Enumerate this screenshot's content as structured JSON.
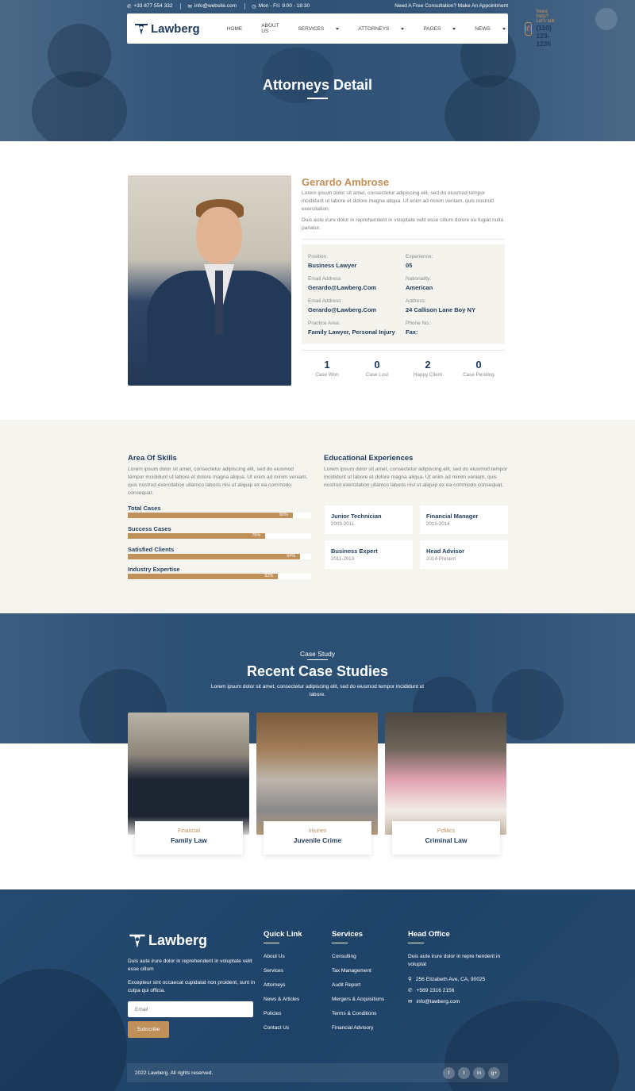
{
  "topbar": {
    "phone": "+33 877 554 332",
    "email": "info@website.com",
    "hours": "Mon - Fri: 9:00 - 18:30",
    "cta": "Need A Free Consultation? Make An Appointment"
  },
  "brand": {
    "name": "Lawberg",
    "primary": "#1f3a5a",
    "accent": "#c0905a"
  },
  "nav": {
    "items": [
      {
        "label": "HOME",
        "caret": false
      },
      {
        "label": "ABOUT US",
        "caret": false
      },
      {
        "label": "SERVICES",
        "caret": true
      },
      {
        "label": "ATTORNEYS",
        "caret": true
      },
      {
        "label": "PAGES",
        "caret": true
      },
      {
        "label": "NEWS",
        "caret": true
      }
    ],
    "help_label": "Need Help? Let's talk",
    "help_phone": "(110) 123-1235"
  },
  "hero": {
    "title": "Attorneys Detail"
  },
  "profile": {
    "name": "Gerardo Ambrose",
    "desc1": "Lorem ipsum dolor sit amet, consectetur adipiscing elit, sed do eiusmod tempor incididunt ut labore et dolore magna aliqua. Ut enim ad minim veniam, quis nostrud exercitation.",
    "desc2": "Duis aute irure dolor in reprehenderit in voluptate velit esse cillum dolore eu fugiat nulla pariatur.",
    "info": [
      {
        "k": "Position:",
        "v": "Business Lawyer"
      },
      {
        "k": "Experience:",
        "v": "05"
      },
      {
        "k": "Email Address",
        "v": "Gerardo@Lawberg.Com"
      },
      {
        "k": "Nationality:",
        "v": "American"
      },
      {
        "k": "Email Address",
        "v": "Gerardo@Lawberg.Com"
      },
      {
        "k": "Address:",
        "v": "24 Callison Lane Boy NY"
      },
      {
        "k": "Practice Area:",
        "v": "Family Lawyer, Personal Injury"
      },
      {
        "k": "Phone No.:",
        "v": "Fax:"
      }
    ],
    "stats": [
      {
        "n": "1",
        "l": "Case Won"
      },
      {
        "n": "0",
        "l": "Case Lost"
      },
      {
        "n": "2",
        "l": "Happy Client"
      },
      {
        "n": "0",
        "l": "Case Pending"
      }
    ]
  },
  "skills": {
    "title": "Area Of Skills",
    "desc": "Lorem ipsum dolor sit amet, consectetur adipiscing elit, sed do eiusmod tempor incididunt ut labore et dolore magna aliqua. Ut enim ad minim veniam, quis nostrud exercitation ullamco laboris nisi ut aliquip ex ea commodo consequat.",
    "items": [
      {
        "label": "Total Cases",
        "pct": 90,
        "text": "90%"
      },
      {
        "label": "Success Cases",
        "pct": 75,
        "text": "75%"
      },
      {
        "label": "Satisfied Clients",
        "pct": 94,
        "text": "94%"
      },
      {
        "label": "Industry Expertise",
        "pct": 82,
        "text": "82%"
      }
    ]
  },
  "education": {
    "title": "Educational Experiences",
    "desc": "Lorem ipsum dolor sit amet, consectetur adipiscing elit, sed do eiusmod tempor incididunt ut labore et dolore magna aliqua. Ut enim ad minim veniam, quis nostrud exercitation ullamco laboris nisi ut aliquip ex ea commodo consequat.",
    "items": [
      {
        "t": "Junior Technician",
        "d": "2009-2011"
      },
      {
        "t": "Financial Manager",
        "d": "2013-2014"
      },
      {
        "t": "Business Expert",
        "d": "2011-2013"
      },
      {
        "t": "Head Advisor",
        "d": "2014-Present"
      }
    ]
  },
  "cases": {
    "sub": "Case Study",
    "title": "Recent Case Studies",
    "desc": "Lorem ipsum dolor sit amet, consectetur adipiscing elit, sed do eiusmod tempor incididunt ut labore.",
    "items": [
      {
        "c": "Financial",
        "t": "Family Law"
      },
      {
        "c": "Injuries",
        "t": "Juvenile Crime"
      },
      {
        "c": "Politics",
        "t": "Criminal Law"
      }
    ]
  },
  "footer": {
    "about1": "Duis aute irure dolor in reprehenderit in voluptate velit esse cillum",
    "about2": "Excepteur sint occaecat cupidatat non proident, sunt in culpa qui officia.",
    "email_placeholder": "Email",
    "subscribe": "Subscribe",
    "quick_title": "Quick Link",
    "quick": [
      "About Us",
      "Services",
      "Attorneys",
      "News & Articles",
      "Policies",
      "Contact Us"
    ],
    "services_title": "Services",
    "services": [
      "Consulting",
      "Tax Management",
      "Audit Report",
      "Mergers & Acquisitions",
      "Terms & Conditions",
      "Financial Advisory"
    ],
    "office_title": "Head Office",
    "office_desc": "Duis aute irure dolor in repre henderit in voluptat",
    "address": "256 Elizabeth Ave, CA, 90025",
    "phone": "+569 2316 2156",
    "email": "info@lawberg.com",
    "copyright": "2022 Lawberg. All rights reserved.",
    "social": [
      "f",
      "t",
      "in",
      "g+"
    ]
  }
}
